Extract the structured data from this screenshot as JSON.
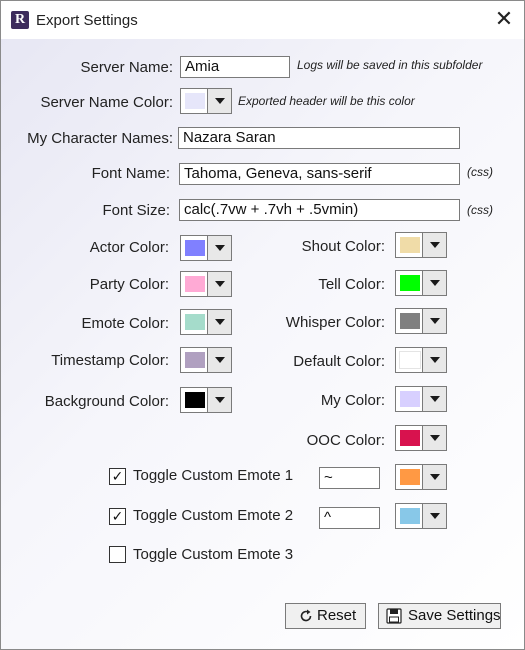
{
  "window": {
    "title": "Export Settings",
    "close_glyph": "✕"
  },
  "app_icon": {
    "glyph": "R"
  },
  "fields": {
    "server_name": {
      "label": "Server Name:",
      "value": "Amia",
      "hint": "Logs will be saved in this subfolder"
    },
    "server_name_color": {
      "label": "Server Name Color:",
      "color": "#e6e6fa",
      "hint": "Exported header will be this color"
    },
    "my_character_names": {
      "label": "My Character Names:",
      "value": "Nazara Saran"
    },
    "font_name": {
      "label": "Font Name:",
      "value": "Tahoma, Geneva, sans-serif",
      "hint": "(css)"
    },
    "font_size": {
      "label": "Font Size:",
      "value": "calc(.7vw + .7vh + .5vmin)",
      "hint": "(css)"
    }
  },
  "colors_left": [
    {
      "label": "Actor Color:",
      "color": "#8080ff"
    },
    {
      "label": "Party Color:",
      "color": "#ffaad5"
    },
    {
      "label": "Emote Color:",
      "color": "#a5dccb"
    },
    {
      "label": "Timestamp Color:",
      "color": "#b0a0c0"
    },
    {
      "label": "Background Color:",
      "color": "#000000"
    }
  ],
  "colors_right": [
    {
      "label": "Shout Color:",
      "color": "#f0dca8"
    },
    {
      "label": "Tell Color:",
      "color": "#00ff00"
    },
    {
      "label": "Whisper Color:",
      "color": "#808080"
    },
    {
      "label": "Default Color:",
      "color": "#ffffff"
    },
    {
      "label": "My Color:",
      "color": "#d8d0ff"
    },
    {
      "label": "OOC Color:",
      "color": "#d8124e"
    }
  ],
  "custom_emotes": [
    {
      "label": "Toggle Custom Emote 1",
      "checked": true,
      "check_glyph": "✓",
      "value": "~",
      "color": "#ff9944"
    },
    {
      "label": "Toggle Custom Emote 2",
      "checked": true,
      "check_glyph": "✓",
      "value": "^",
      "color": "#88c8e8"
    },
    {
      "label": "Toggle Custom Emote 3",
      "checked": false,
      "check_glyph": ""
    }
  ],
  "buttons": {
    "reset": {
      "label": "Reset",
      "icon": "refresh-icon"
    },
    "save": {
      "label": "Save Settings",
      "icon": "floppy-disk-icon"
    }
  }
}
